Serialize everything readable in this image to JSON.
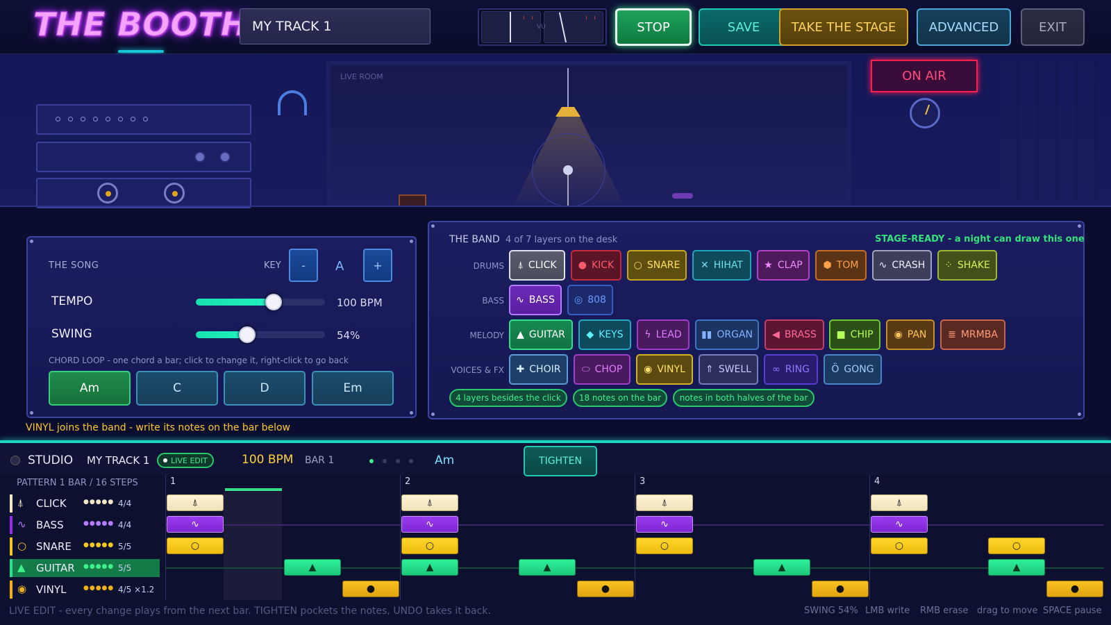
{
  "header": {
    "logo": "THE BOOTH",
    "track_name": "MY TRACK 1",
    "vu_label": "VU",
    "buttons": {
      "stop": "STOP",
      "save": "SAVE",
      "stage": "TAKE THE STAGE",
      "advanced": "ADVANCED",
      "exit": "EXIT"
    }
  },
  "scene": {
    "live_room_label": "LIVE ROOM",
    "on_air": "ON AIR"
  },
  "song": {
    "title": "THE SONG",
    "key_label": "KEY",
    "key_minus": "-",
    "key_value": "A",
    "key_plus": "+",
    "tempo_label": "TEMPO",
    "tempo_value": "100 BPM",
    "tempo_fill": 0.6,
    "swing_label": "SWING",
    "swing_value": "54%",
    "swing_fill": 0.4,
    "chord_hint": "CHORD LOOP - one chord a bar; click to change it, right-click to go back",
    "chords": [
      "Am",
      "C",
      "D",
      "Em"
    ],
    "active_chord": 0
  },
  "vinyl_hint": "VINYL joins the band - write its notes on the bar below",
  "band": {
    "title": "THE BAND",
    "subtitle": "4 of 7 layers on the desk",
    "status": "STAGE-READY - a night can draw this one",
    "row_labels": {
      "drums": "DRUMS",
      "bass": "BASS",
      "melody": "MELODY",
      "voices": "VOICES & FX"
    },
    "drums": [
      "CLICK",
      "KICK",
      "SNARE",
      "HIHAT",
      "CLAP",
      "TOM",
      "CRASH",
      "SHAKE"
    ],
    "bass": [
      "BASS",
      "808"
    ],
    "melody": [
      "GUITAR",
      "KEYS",
      "LEAD",
      "ORGAN",
      "BRASS",
      "CHIP",
      "PAN",
      "MRMBA"
    ],
    "voices": [
      "CHOIR",
      "CHOP",
      "VINYL",
      "SWELL",
      "RING",
      "GONG"
    ],
    "goals": [
      "4 layers besides the click",
      "18 notes on the bar",
      "notes in both halves of the bar"
    ]
  },
  "studio": {
    "title": "STUDIO",
    "track": "MY TRACK 1",
    "live_edit": "LIVE EDIT",
    "bpm": "100 BPM",
    "bar": "BAR 1",
    "chord": "Am",
    "tighten": "TIGHTEN",
    "pattern_label": "PATTERN  1 BAR / 16 STEPS",
    "bar_numbers": [
      "1",
      "2",
      "3",
      "4"
    ],
    "tracks": [
      {
        "name": "CLICK",
        "count": "4/4"
      },
      {
        "name": "BASS",
        "count": "4/4"
      },
      {
        "name": "SNARE",
        "count": "5/5"
      },
      {
        "name": "GUITAR",
        "count": "5/5"
      },
      {
        "name": "VINYL",
        "count": "4/5  ×1.2"
      }
    ],
    "footer_hint": "LIVE EDIT - every change plays from the next bar. TIGHTEN pockets the notes, UNDO takes it back.",
    "footer_keys": [
      "SWING 54%",
      "LMB write",
      "RMB erase",
      "drag to move",
      "SPACE pause"
    ]
  },
  "colors": {
    "accent_teal": "#1cd6c0",
    "click": "#f2e6c4",
    "bass": "#8e32e4",
    "snare": "#f6c81c",
    "guitar": "#28e08e",
    "vinyl": "#eeb218"
  },
  "icons": {
    "click": "metronome-icon",
    "kick": "circle-icon",
    "snare": "ring-icon",
    "hihat": "x-icon",
    "clap": "star-icon",
    "tom": "hexagon-icon",
    "crash": "wave-icon",
    "shake": "sparkle-icon",
    "bass": "wave-icon",
    "guitar": "triangle-icon",
    "vinyl": "record-icon"
  }
}
